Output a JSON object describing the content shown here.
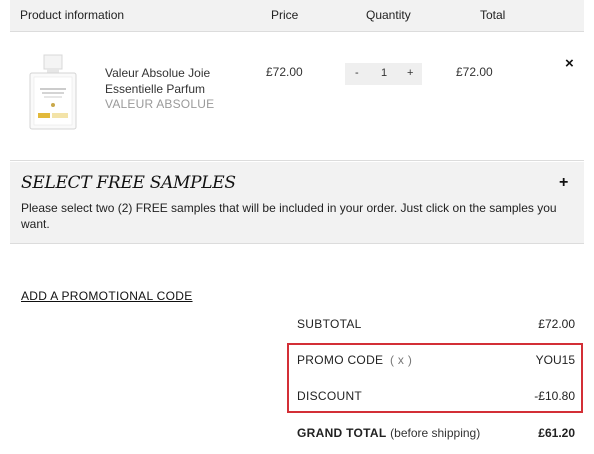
{
  "table_header": {
    "product": "Product information",
    "price": "Price",
    "quantity": "Quantity",
    "total": "Total"
  },
  "cart_item": {
    "name": "Valeur Absolue Joie Essentielle Parfum",
    "brand": "VALEUR ABSOLUE",
    "price": "£72.00",
    "quantity": "1",
    "qty_minus": "-",
    "qty_plus": "+",
    "total": "£72.00",
    "remove": "×",
    "image_icon": "perfume-bottle"
  },
  "samples": {
    "title": "SELECT FREE SAMPLES",
    "expand": "+",
    "description": "Please select two (2) FREE samples that will be included in your order. Just click on the samples you want."
  },
  "promo_link": "ADD A PROMOTIONAL CODE",
  "summary": {
    "subtotal_label": "SUBTOTAL",
    "subtotal_value": "£72.00",
    "promo_label": "PROMO CODE",
    "promo_remove": "( x )",
    "promo_value": "YOU15",
    "discount_label": "DISCOUNT",
    "discount_value": "-£10.80",
    "grand_label": "GRAND TOTAL",
    "grand_note": "(before shipping)",
    "grand_value": "£61.20"
  },
  "colors": {
    "highlight": "#d32f36",
    "header_bg": "#f2f2f2",
    "brand_text": "#9a9a9a"
  }
}
